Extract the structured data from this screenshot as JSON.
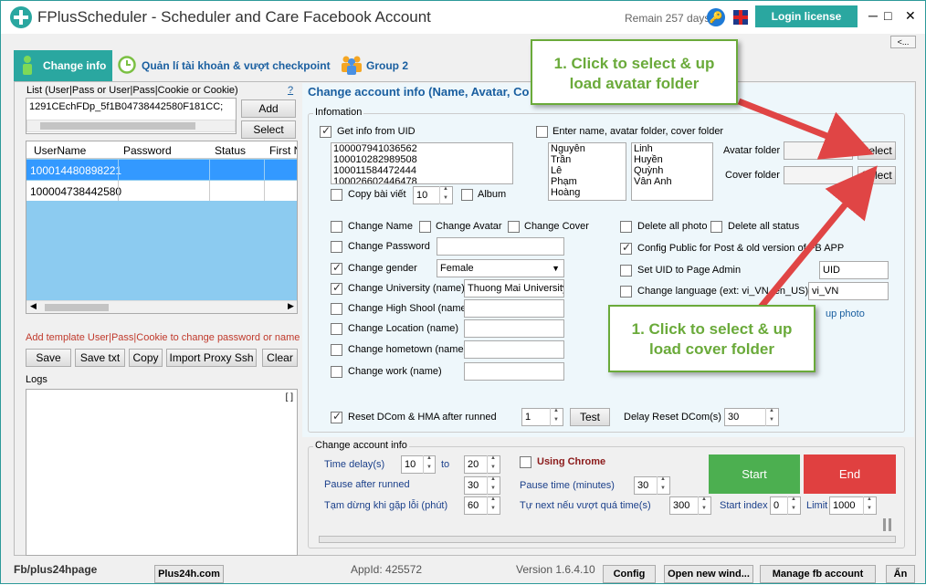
{
  "window": {
    "title": "FPlusScheduler - Scheduler and Care Facebook Account",
    "remain": "Remain 257 days",
    "login_label": "Login license",
    "collapse_label": "<..."
  },
  "tabs": [
    {
      "label": "Change info",
      "active": true
    },
    {
      "label": "Quản lí tài khoản & vượt checkpoint",
      "active": false
    },
    {
      "label": "Group 2",
      "active": false
    }
  ],
  "left": {
    "list_label": "List (User|Pass or User|Pass|Cookie or Cookie)",
    "help": "?",
    "list_value": "1291CEchFDp_5f1B04738442580F181CC;",
    "add_label": "Add",
    "select_label": "Select",
    "columns": [
      "UserName",
      "Password",
      "Status",
      "First Na"
    ],
    "rows": [
      {
        "username": "100014480898221",
        "password": "",
        "status": "",
        "first": ""
      },
      {
        "username": "100004738442580",
        "password": "",
        "status": "",
        "first": ""
      }
    ],
    "template_hint": "Add template User|Pass|Cookie to change password or name",
    "buttons": [
      "Save",
      "Save txt",
      "Copy",
      "Import Proxy Ssh",
      "Clear"
    ],
    "logs_label": "Logs",
    "logs_toggle": "[ ]"
  },
  "change_info": {
    "header": "Change account info (Name, Avatar, Co",
    "infomation_label": "Infomation",
    "get_uid_label": "Get info from UID",
    "uids": [
      "100007941036562",
      "100010282989508",
      "100011584472444",
      "100026602446478"
    ],
    "enter_name_label": "Enter name, avatar folder, cover folder",
    "first_names": [
      "Nguyễn",
      "Trần",
      "Lê",
      "Phạm",
      "Hoàng"
    ],
    "last_names": [
      "Linh",
      "Huyền",
      "Quỳnh",
      "Vân Anh"
    ],
    "avatar_folder_label": "Avatar folder",
    "cover_folder_label": "Cover folder",
    "select_label": "Select",
    "copy_post_label": "Copy bài viết",
    "copy_post_value": "10",
    "album_label": "Album",
    "change_name": "Change Name",
    "change_avatar": "Change Avatar",
    "change_cover": "Change Cover",
    "delete_photo": "Delete all photo",
    "delete_status": "Delete all status",
    "change_password": "Change Password",
    "config_public": "Config Public for Post & old version of FB APP",
    "change_gender": "Change gender",
    "gender_value": "Female",
    "set_uid_admin": "Set UID to Page Admin",
    "uid_value": "UID",
    "change_university": "Change University (name)",
    "university_value": "Thuong Mai University",
    "change_language": "Change language (ext: vi_VN, en_US)",
    "language_value": "vi_VN",
    "change_highschool": "Change High Shool (name)",
    "upload_photo": "up photo",
    "change_location": "Change Location (name)",
    "change_hometown": "Change hometown (name)",
    "change_work": "Change work (name)",
    "reset_dcom_label": "Reset DCom & HMA after runned",
    "reset_value": "1",
    "test_label": "Test",
    "delay_reset_label": "Delay Reset DCom(s)",
    "delay_reset_value": "30"
  },
  "run": {
    "group_label": "Change account info",
    "time_delay_label": "Time delay(s)",
    "time_delay_from": "10",
    "to_label": "to",
    "time_delay_to": "20",
    "using_chrome": "Using Chrome",
    "pause_after_label": "Pause after runned",
    "pause_after_value": "30",
    "pause_time_label": "Pause time (minutes)",
    "pause_time_value": "30",
    "stop_error_label": "Tạm dừng khi gặp lỗi (phút)",
    "stop_error_value": "60",
    "auto_next_label": "Tự next nếu vượt quá time(s)",
    "auto_next_value": "300",
    "start_index_label": "Start index",
    "start_index_value": "0",
    "limit_label": "Limit",
    "limit_value": "1000",
    "start_label": "Start",
    "end_label": "End"
  },
  "callouts": {
    "avatar": "1. Click to select & up load avatar folder",
    "cover": "1. Click to select & up load cover folder"
  },
  "statusbar": {
    "fb": "Fb/plus24hpage",
    "site": "Plus24h.com",
    "appid": "AppId: 425572",
    "version": "Version 1.6.4.10",
    "config": "Config",
    "open_new": "Open new wind...",
    "manage": "Manage fb account",
    "hide": "Ẩn"
  },
  "colors": {
    "accent": "#2aa7a0",
    "start": "#4caf50",
    "end": "#e04040",
    "callout": "#6aaa3a",
    "arrow": "#e04545"
  }
}
